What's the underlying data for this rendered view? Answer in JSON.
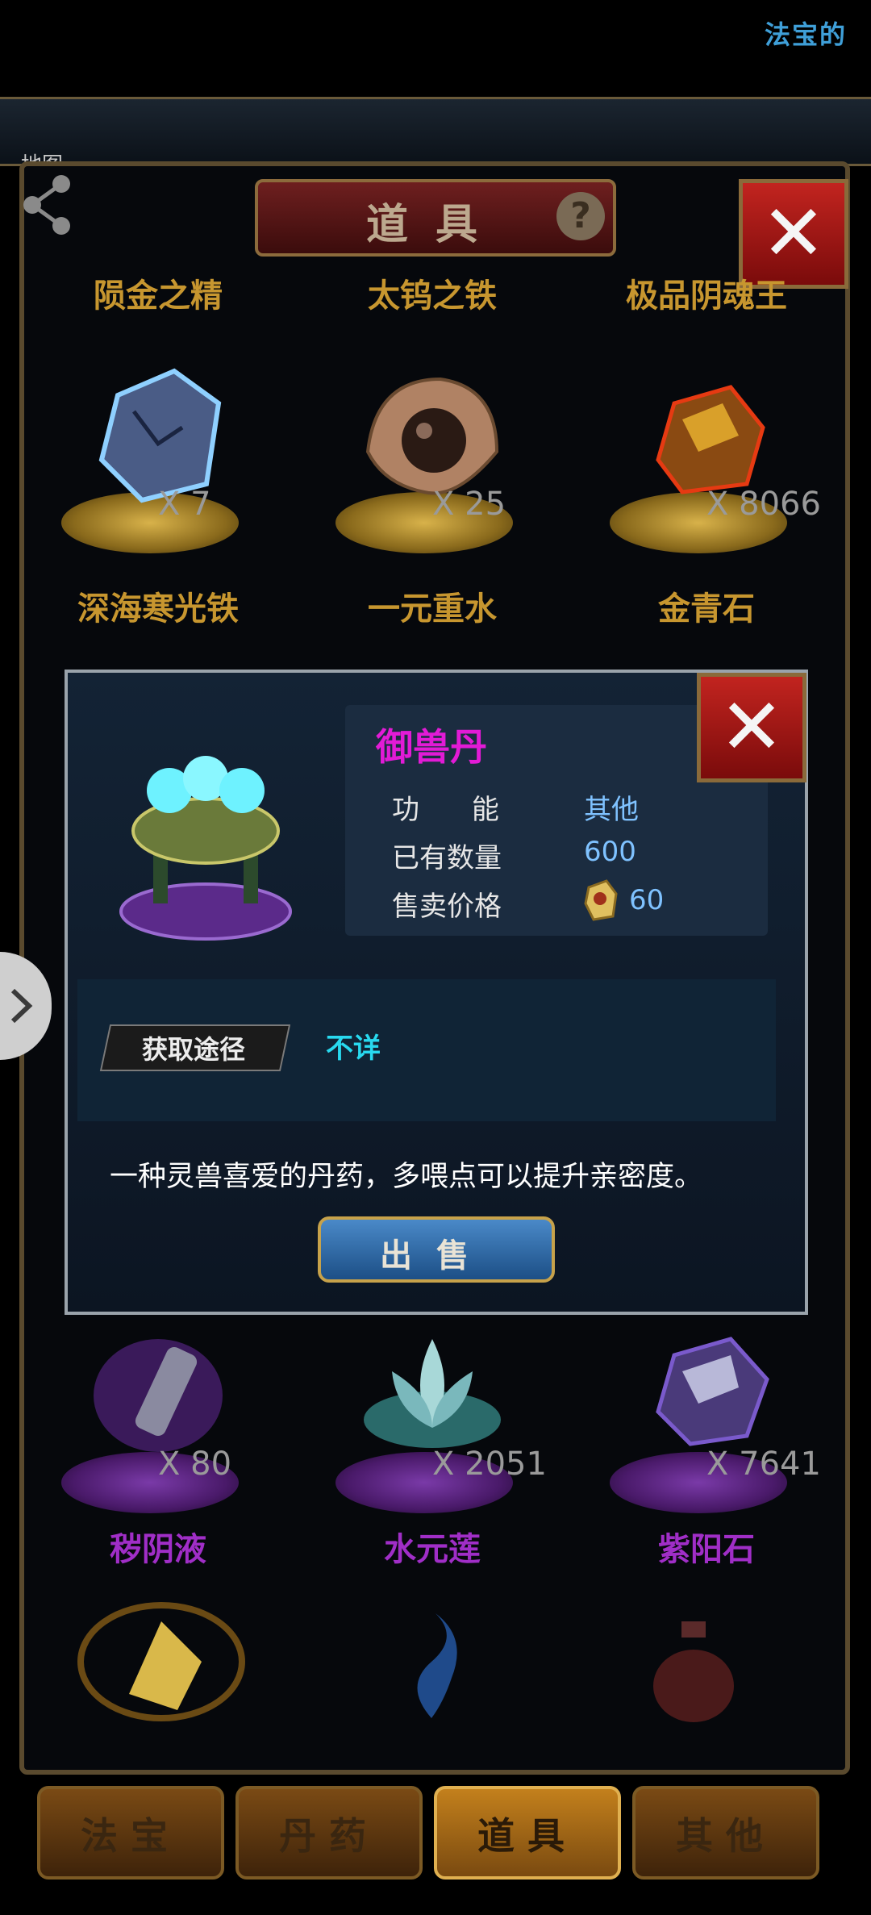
{
  "topbar": {
    "title": "法宝的"
  },
  "map_label": "地图",
  "dialog": {
    "title": "道具"
  },
  "items_top": [
    {
      "name": "陨金之精"
    },
    {
      "name": "太钨之铁"
    },
    {
      "name": "极品阴魂王"
    }
  ],
  "items_row2": [
    {
      "name": "深海寒光铁",
      "count": "X 7"
    },
    {
      "name": "一元重水",
      "count": "X 25"
    },
    {
      "name": "金青石",
      "count": "X 8066"
    }
  ],
  "items_row3": [
    {
      "name": "秽阴液",
      "count": "X 80"
    },
    {
      "name": "水元莲",
      "count": "X 2051"
    },
    {
      "name": "紫阳石",
      "count": "X 7641"
    }
  ],
  "popup": {
    "item_name": "御兽丹",
    "function_label": "功      能",
    "function_value": "其他",
    "quantity_label": "已有数量",
    "quantity_value": "600",
    "price_label": "售卖价格",
    "price_value": "60",
    "source_label": "获取途径",
    "source_value": "不详",
    "description": "一种灵兽喜爱的丹药，多喂点可以提升亲密度。",
    "sell_button": "出售"
  },
  "tabs": [
    {
      "label": "法宝",
      "active": false
    },
    {
      "label": "丹药",
      "active": false
    },
    {
      "label": "道具",
      "active": true
    },
    {
      "label": "其他",
      "active": false
    }
  ],
  "colors": {
    "gold_text": "#c7962f",
    "purple_text": "#a02ec7",
    "item_name": "#e21bd6",
    "source": "#28d9ef"
  },
  "icons": [
    "share-icon",
    "help-icon",
    "close-icon",
    "chevron-right-icon",
    "spirit-stone-icon"
  ]
}
